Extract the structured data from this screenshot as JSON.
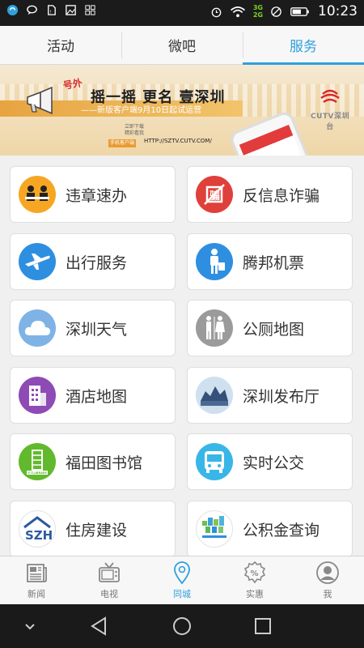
{
  "status_bar": {
    "time": "10:23",
    "network_3g": "3G",
    "network_2g": "2G",
    "icons": [
      "app-notification-icon",
      "chat-icon",
      "sim-icon",
      "image-icon",
      "grid-icon",
      "alarm-icon",
      "wifi-icon",
      "no-sim-icon",
      "battery-icon"
    ]
  },
  "top_tabs": [
    {
      "label": "活动",
      "active": false
    },
    {
      "label": "微吧",
      "active": false
    },
    {
      "label": "服务",
      "active": true
    }
  ],
  "banner": {
    "tag": "号外",
    "headline": "摇一摇 更名 壹深圳",
    "subline": "——新版客户端9月10日起试运营",
    "small_text_1": "立即下载",
    "small_text_2": "精彩看我",
    "url_label": "手机客户端",
    "url": "HTTP://SZTV.CUTV.COM/",
    "logo_text": "CUTV深圳台"
  },
  "services": [
    {
      "label": "违章速办",
      "icon": "traffic-violation-icon",
      "color": "#f6a623"
    },
    {
      "label": "反信息诈骗",
      "icon": "anti-fraud-icon",
      "color": "#e0403a"
    },
    {
      "label": "出行服务",
      "icon": "airplane-icon",
      "color": "#2e8fe0"
    },
    {
      "label": "腾邦机票",
      "icon": "traveler-icon",
      "color": "#2e8fe0"
    },
    {
      "label": "深圳天气",
      "icon": "cloud-icon",
      "color": "#7fb3e6"
    },
    {
      "label": "公厕地图",
      "icon": "restroom-icon",
      "color": "#9b9b9b"
    },
    {
      "label": "酒店地图",
      "icon": "hotel-icon",
      "color": "#8e4bb5"
    },
    {
      "label": "深圳发布厅",
      "icon": "shenzhen-release-icon",
      "color": "#b7d0e8"
    },
    {
      "label": "福田图书馆",
      "icon": "library-icon",
      "color": "#62b92d"
    },
    {
      "label": "实时公交",
      "icon": "bus-icon",
      "color": "#38b6e8"
    },
    {
      "label": "住房建设",
      "icon": "housing-icon",
      "color": "#ffffff"
    },
    {
      "label": "公积金查询",
      "icon": "housing-fund-icon",
      "color": "#ffffff"
    }
  ],
  "bottom_nav": [
    {
      "label": "新闻",
      "icon": "newspaper-icon",
      "active": false
    },
    {
      "label": "电视",
      "icon": "tv-icon",
      "active": false
    },
    {
      "label": "同城",
      "icon": "location-pin-icon",
      "active": true
    },
    {
      "label": "实惠",
      "icon": "discount-icon",
      "active": false
    },
    {
      "label": "我",
      "icon": "user-icon",
      "active": false
    }
  ],
  "colors": {
    "accent": "#2ea0dd",
    "status_bar": "#1b1b1b"
  }
}
